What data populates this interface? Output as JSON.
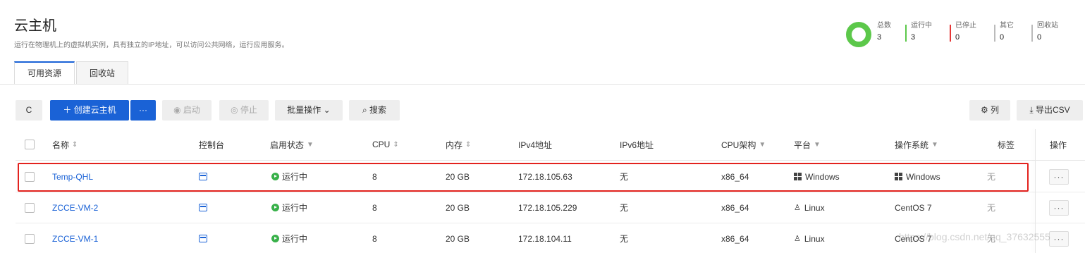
{
  "page": {
    "title": "云主机",
    "subtitle": "运行在物理机上的虚拟机实例，具有独立的IP地址，可以访问公共网络，运行应用服务。"
  },
  "stats": [
    {
      "label": "总数",
      "value": "3"
    },
    {
      "label": "运行中",
      "value": "3"
    },
    {
      "label": "已停止",
      "value": "0"
    },
    {
      "label": "其它",
      "value": "0"
    },
    {
      "label": "回收站",
      "value": "0"
    }
  ],
  "tabs": [
    {
      "label": "可用资源",
      "active": true
    },
    {
      "label": "回收站",
      "active": false
    }
  ],
  "toolbar": {
    "refresh": "C",
    "create": "＋ 创建云主机",
    "more": "···",
    "start": "◉ 启动",
    "stop": "◎ 停止",
    "batch": "批量操作 ⌄",
    "search": "⌕ 搜索",
    "columns": "⚙ 列",
    "export": "⤓ 导出CSV"
  },
  "columns": {
    "name": "名称",
    "console": "控制台",
    "status": "启用状态",
    "cpu": "CPU",
    "memory": "内存",
    "ipv4": "IPv4地址",
    "ipv6": "IPv6地址",
    "arch": "CPU架构",
    "platform": "平台",
    "os": "操作系统",
    "tags": "标签",
    "actions": "操作"
  },
  "rows": [
    {
      "name": "Temp-QHL",
      "status": "运行中",
      "cpu": "8",
      "memory": "20 GB",
      "ipv4": "172.18.105.63",
      "ipv6": "无",
      "arch": "x86_64",
      "platform": "Windows",
      "os": "Windows",
      "tags": "无",
      "more": "···"
    },
    {
      "name": "ZCCE-VM-2",
      "status": "运行中",
      "cpu": "8",
      "memory": "20 GB",
      "ipv4": "172.18.105.229",
      "ipv6": "无",
      "arch": "x86_64",
      "platform": "Linux",
      "os": "CentOS 7",
      "tags": "无",
      "more": "···"
    },
    {
      "name": "ZCCE-VM-1",
      "status": "运行中",
      "cpu": "8",
      "memory": "20 GB",
      "ipv4": "172.18.104.11",
      "ipv6": "无",
      "arch": "x86_64",
      "platform": "Linux",
      "os": "CentOS 7",
      "tags": "无",
      "more": "···"
    }
  ],
  "watermark": "https://blog.csdn.net/qq_37632555",
  "colors": {
    "accent": "#1a62d6",
    "running": "#39b14a",
    "stopped": "#e63636",
    "highlight": "#e3231f"
  }
}
